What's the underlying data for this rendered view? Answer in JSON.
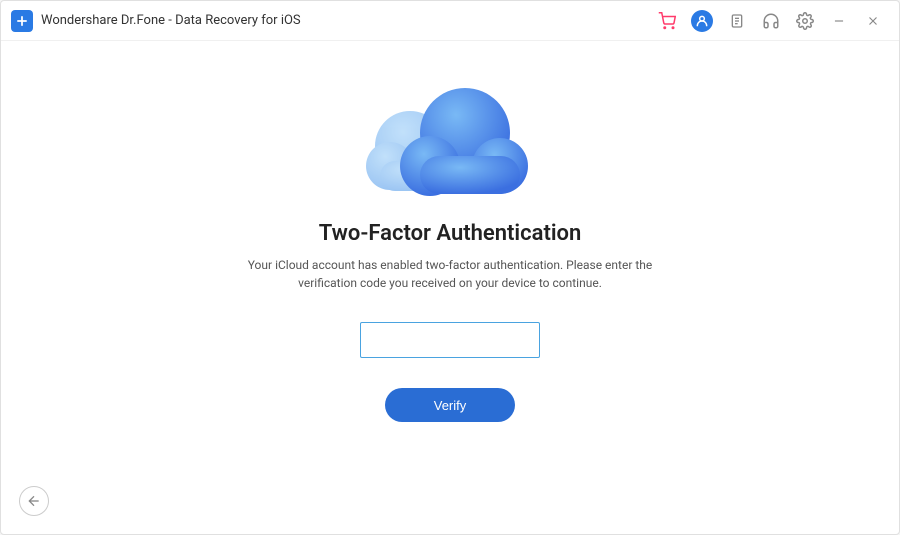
{
  "window": {
    "title": "Wondershare Dr.Fone - Data Recovery for iOS"
  },
  "icons": {
    "cart": "cart-icon",
    "account": "account-icon",
    "document": "document-icon",
    "support": "support-icon",
    "settings": "settings-icon",
    "minimize": "minimize-icon",
    "close": "close-icon",
    "back": "back-icon"
  },
  "main": {
    "heading": "Two-Factor Authentication",
    "description": "Your iCloud account has enabled two-factor authentication. Please enter the verification code you received on your device to continue.",
    "code_value": "",
    "verify_label": "Verify"
  }
}
